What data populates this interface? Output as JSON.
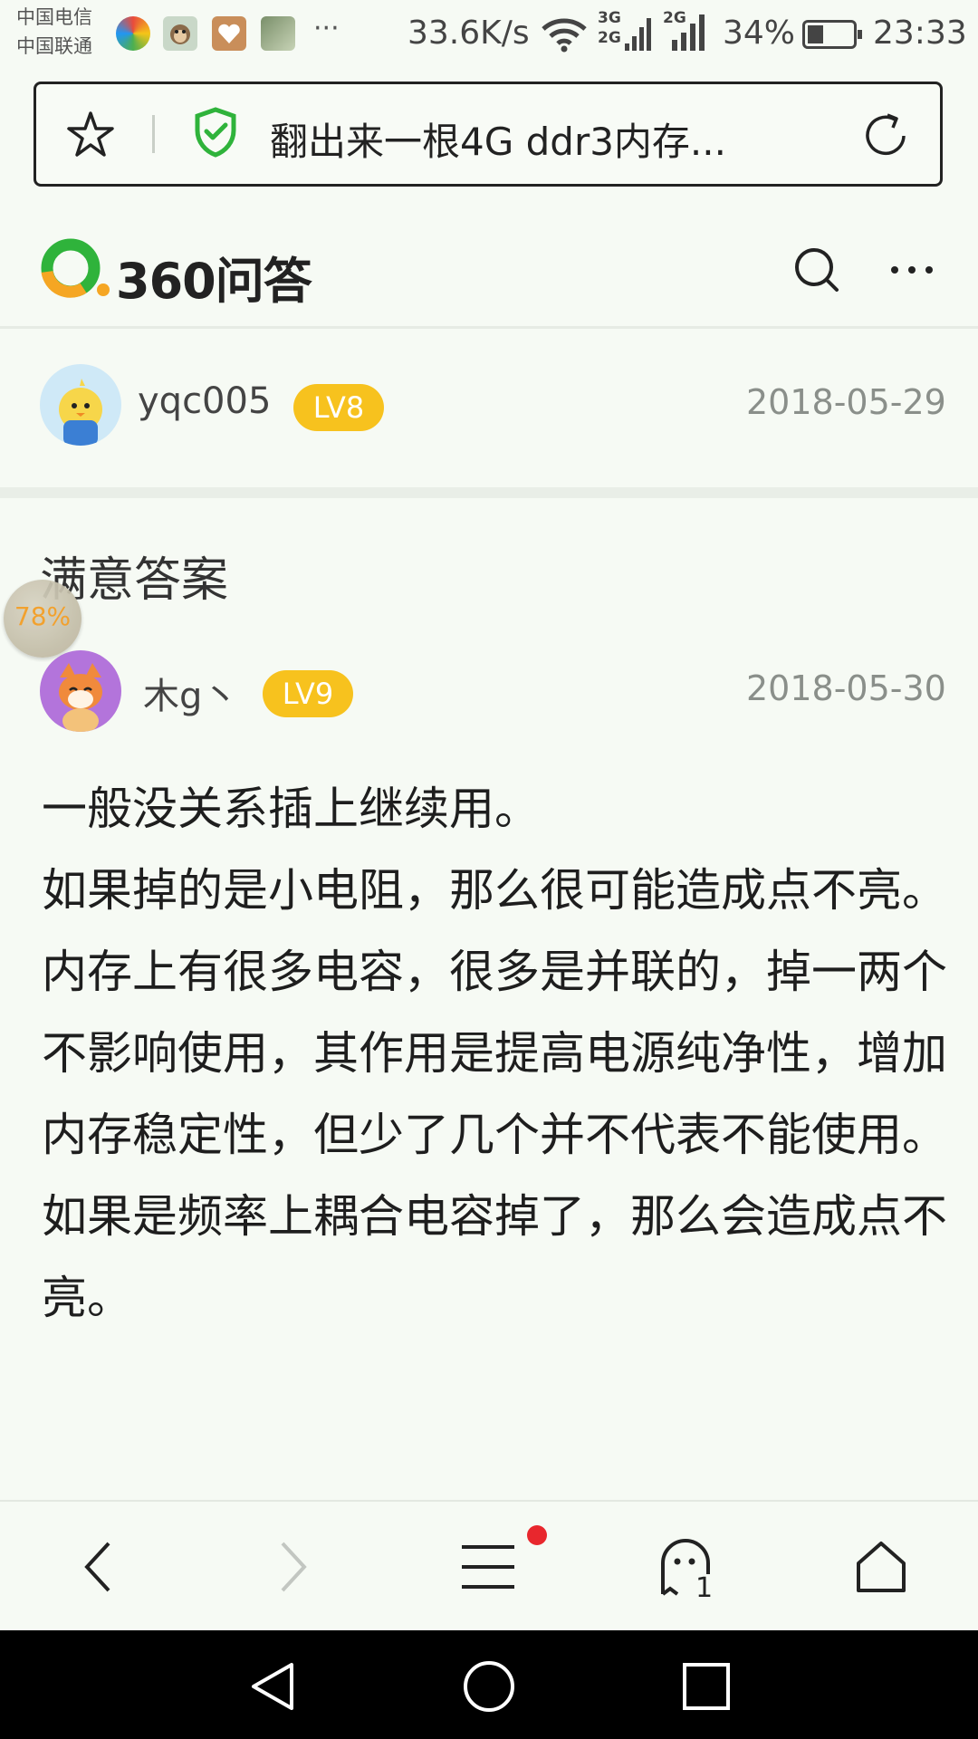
{
  "status_bar": {
    "carrier_1": "中国电信",
    "carrier_2": "中国联通",
    "more": "···",
    "net_speed": "33.6K/s",
    "net_3g_top": "3G",
    "net_3g_bottom": "2G",
    "net_2g": "2G",
    "battery": "34%",
    "time": "23:33",
    "app_icons": [
      "colorful-app-icon",
      "monkey-app-icon",
      "heart-app-icon",
      "photo-app-icon"
    ]
  },
  "url_bar": {
    "title": "翻出来一根4G ddr3内存..."
  },
  "site": {
    "logo_text": "360问答",
    "logo_colors": {
      "green": "#2fb33b",
      "orange": "#f5a623"
    }
  },
  "question_user": {
    "name": "yqc005",
    "level": "LV8",
    "date": "2018-05-29"
  },
  "answer": {
    "section_title": "满意答案",
    "progress_badge": "78%",
    "user": {
      "name": "木g丶",
      "level": "LV9",
      "date": "2018-05-30"
    },
    "paragraphs": [
      "一般没关系插上继续用。",
      "如果掉的是小电阻，那么很可能造成点不亮。",
      "内存上有很多电容，很多是并联的，掉一两个不影响使用，其作用是提高电源纯净性，增加内存稳定性，但少了几个并不代表不能使用。",
      "如果是频率上耦合电容掉了，那么会造成点不亮。"
    ]
  },
  "bottom_nav": {
    "ghost_count": "1"
  },
  "colors": {
    "accent_yellow": "#f7c21e",
    "background": "#f6faf4",
    "notify_red": "#e8272d"
  }
}
